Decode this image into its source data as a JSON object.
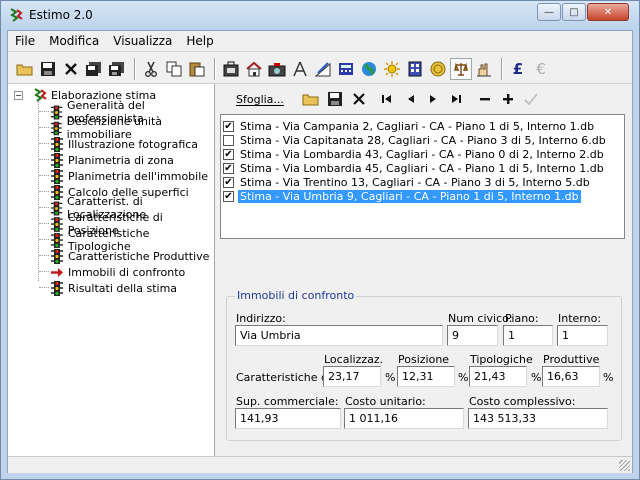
{
  "window": {
    "title": "Estimo 2.0"
  },
  "menu": {
    "items": [
      "File",
      "Modifica",
      "Visualizza",
      "Help"
    ]
  },
  "toolbar": {
    "icons": [
      "open-folder-icon",
      "save-disk-icon",
      "delete-x-icon",
      "floppy-stack-icon",
      "floppy-stack-2-icon",
      "scissors-icon",
      "copy-icon",
      "paste-icon",
      "briefcase-icon",
      "house-icon",
      "camera-icon",
      "compass-icon",
      "drafting-icon",
      "calculator-icon",
      "globe-icon",
      "sun-icon",
      "building-icon",
      "coin-icon",
      "balance-scale-icon",
      "estimate-hand-icon",
      "pound-icon",
      "euro-icon"
    ]
  },
  "tree": {
    "root_label": "Elaborazione stima",
    "items": [
      "Generalità del professionista",
      "Descrizione unità immobiliare",
      "Illustrazione fotografica",
      "Planimetria di zona",
      "Planimetria dell'immobile",
      "Calcolo delle superfici",
      "Caratterist. di Localizzazione",
      "Caratteristiche di Posizione",
      "Caratteristiche Tipologiche",
      "Caratteristiche Produttive",
      "Immobili di confronto",
      "Risultati della stima"
    ],
    "arrow_item_index": 10
  },
  "panel": {
    "sfoglia_label": "Sfoglia..."
  },
  "list": {
    "items": [
      {
        "text": "Stima - Via Campania 2, Cagliari - CA - Piano 1 di 5, Interno 1.db",
        "checked": "✔"
      },
      {
        "text": "Stima - Via Capitanata 28, Cagliari - CA - Piano 3 di 5, Interno 6.db",
        "checked": ""
      },
      {
        "text": "Stima - Via Lombardia 43, Cagliari - CA - Piano 0 di 2, Interno 2.db",
        "checked": "✔"
      },
      {
        "text": "Stima - Via Lombardia 45, Cagliari - CA - Piano 1 di 5, Interno 1.db",
        "checked": "✔"
      },
      {
        "text": "Stima - Via Trentino 13, Cagliari - CA - Piano 3 di 5, Interno 5.db",
        "checked": "✔"
      },
      {
        "text": "Stima - Via Umbria 9, Cagliari - CA - Piano 1 di 5, Interno 1.db",
        "checked": "✔"
      }
    ],
    "selected_index": 5
  },
  "group": {
    "title": "Immobili di confronto",
    "indirizzo_label": "Indirizzo:",
    "indirizzo_value": "Via Umbria",
    "civico_label": "Num civico:",
    "civico_value": "9",
    "piano_label": "Piano:",
    "piano_value": "1",
    "interno_label": "Interno:",
    "interno_value": "1",
    "caratteristiche_label": "Caratteristiche di:",
    "localizz_label": "Localizzaz.",
    "localizz_value": "23,17",
    "posizione_label": "Posizione",
    "posizione_value": "12,31",
    "tipologiche_label": "Tipologiche",
    "tipologiche_value": "21,43",
    "produttive_label": "Produttive",
    "produttive_value": "16,63",
    "pct": "%",
    "sup_label": "Sup. commerciale:",
    "sup_value": "141,93",
    "costo_unit_label": "Costo unitario:",
    "costo_unit_value": "1 011,16",
    "costo_compl_label": "Costo complessivo:",
    "costo_compl_value": "143 513,33"
  }
}
